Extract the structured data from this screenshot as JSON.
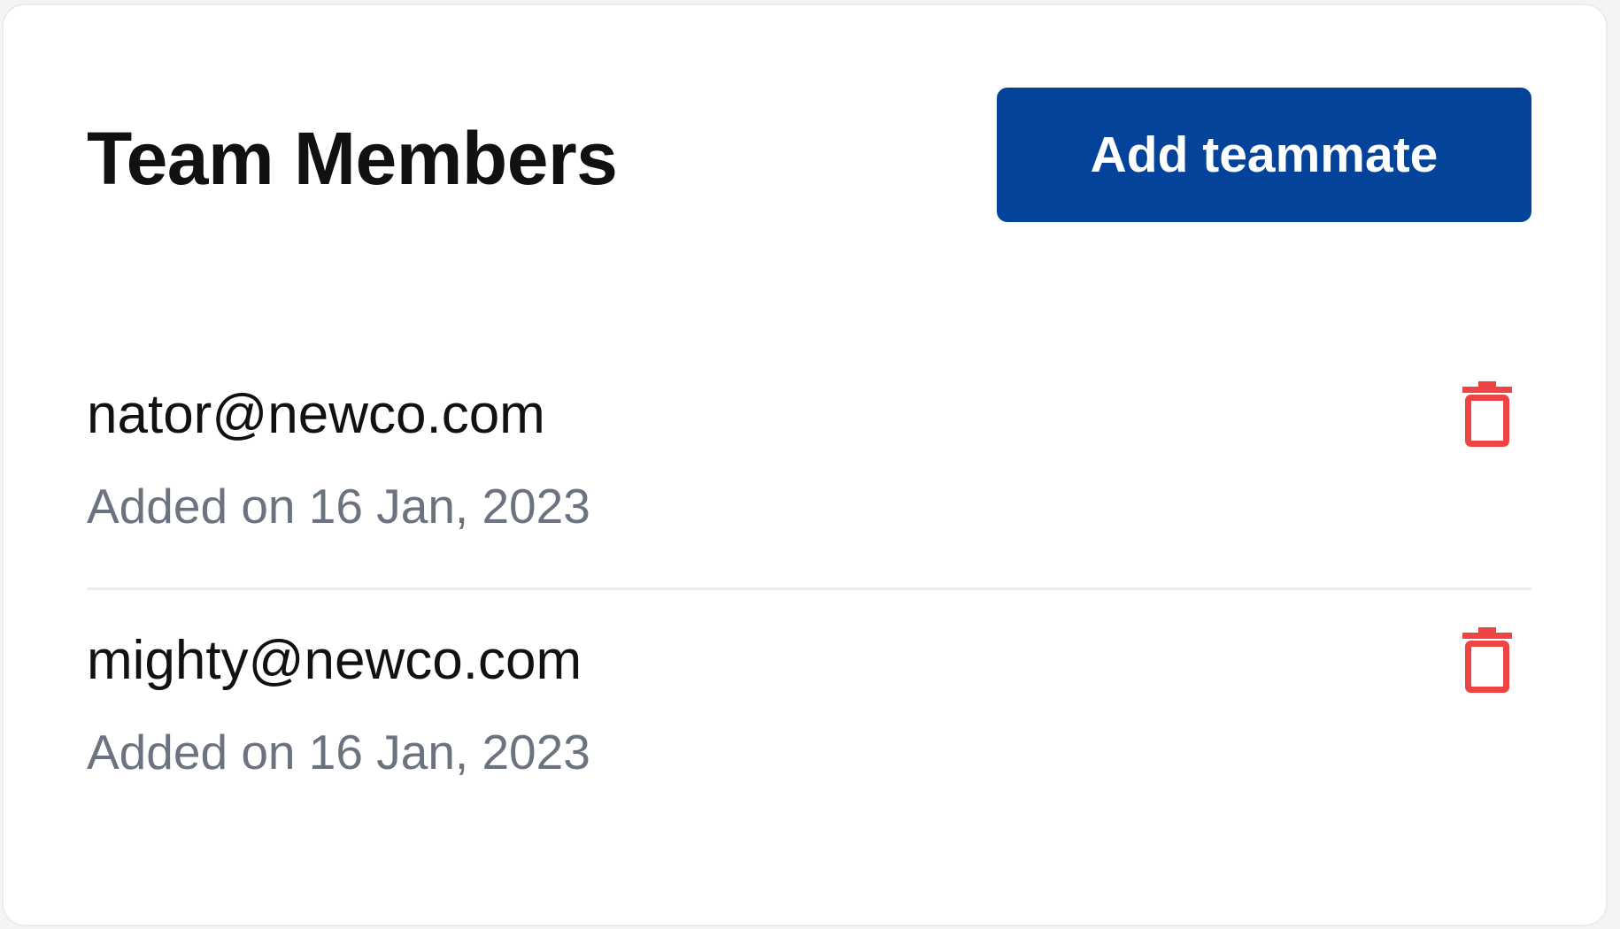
{
  "header": {
    "title": "Team Members",
    "add_button_label": "Add teammate"
  },
  "members": [
    {
      "email": "nator@newco.com",
      "added": "Added on 16 Jan, 2023"
    },
    {
      "email": "mighty@newco.com",
      "added": "Added on 16 Jan, 2023"
    }
  ],
  "icons": {
    "delete": "trash-icon"
  },
  "colors": {
    "accent": "#03449a",
    "danger": "#ef4444",
    "muted_text": "#6b7280"
  }
}
